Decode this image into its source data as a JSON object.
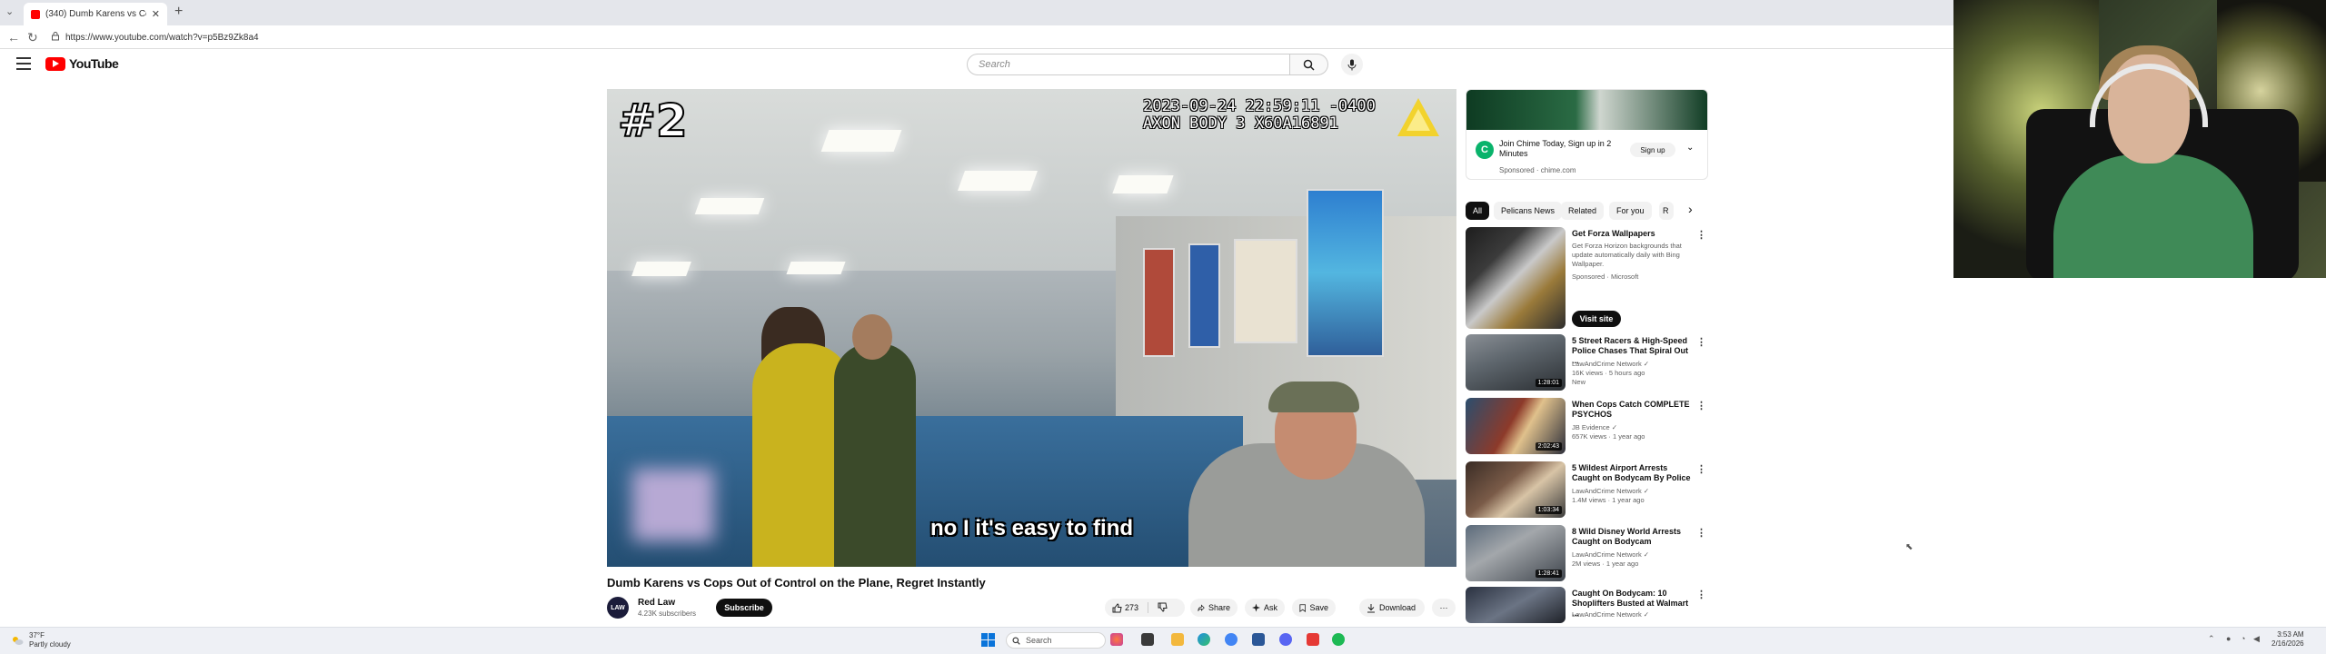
{
  "browser": {
    "tab_title": "(340) Dumb Karens vs Cops O",
    "url": "https://www.youtube.com/watch?v=p5Bz9Zk8a4",
    "newtab": "+",
    "close": "✕",
    "back": "←",
    "reload": "↻",
    "tab_dropdown": "⌄"
  },
  "header": {
    "logo_text": "YouTube",
    "search_placeholder": "Search"
  },
  "video": {
    "badge": "#2",
    "timestamp": "2023-09-24 22:59:11 -0400\nAXON BODY 3 X60A16891",
    "subtitle": "no I it's easy to find",
    "title": "Dumb Karens vs Cops Out of Control on the Plane, Regret Instantly",
    "channel_avatar": "LAW",
    "channel_name": "Red Law",
    "subscribers": "4.23K subscribers",
    "subscribe_label": "Subscribe",
    "likes": "273",
    "share_label": "Share",
    "ask_label": "Ask",
    "save_label": "Save",
    "download_label": "Download",
    "more": "···"
  },
  "ad": {
    "logo": "C",
    "text": "Join Chime Today, Sign up in 2 Minutes",
    "sponsored": "Sponsored · chime.com",
    "button": "Sign up",
    "chevron": "⌄"
  },
  "chips": [
    "All",
    "Pelicans News",
    "Related",
    "For you",
    "R"
  ],
  "chip_next": "›",
  "recommendations": [
    {
      "title": "Get Forza Wallpapers",
      "meta1": "Get Forza Horizon backgrounds that update automatically daily with Bing Wallpaper.",
      "meta2": "Sponsored · Microsoft",
      "visit": "Visit site",
      "duration": ""
    },
    {
      "title": "5 Street Racers & High-Speed Police Chases That Spiral Out ...",
      "meta1": "LawAndCrime Network ✓",
      "meta2": "16K views · 5 hours ago",
      "meta3": "New",
      "duration": "1:28:01"
    },
    {
      "title": "When Cops Catch COMPLETE PSYCHOS",
      "meta1": "JB Evidence ✓",
      "meta2": "657K views · 1 year ago",
      "meta3": "",
      "duration": "2:02:43"
    },
    {
      "title": "5 Wildest Airport Arrests Caught on Bodycam By Police",
      "meta1": "LawAndCrime Network ✓",
      "meta2": "1.4M views · 1 year ago",
      "meta3": "",
      "duration": "1:03:34"
    },
    {
      "title": "8 Wild Disney World Arrests Caught on Bodycam",
      "meta1": "LawAndCrime Network ✓",
      "meta2": "2M views · 1 year ago",
      "meta3": "",
      "duration": "1:28:41"
    },
    {
      "title": "Caught On Bodycam: 10 Shoplifters Busted at Walmart ...",
      "meta1": "LawAndCrime Network ✓",
      "meta2": "",
      "meta3": "",
      "duration": ""
    }
  ],
  "taskbar": {
    "temp": "37°F",
    "weather": "Partly cloudy",
    "search": "Search",
    "time": "3:53 AM",
    "date": "2/16/2026"
  },
  "colors": {
    "youtube_red": "#ff0000",
    "subscribe_bg": "#0f0f0f",
    "chime_green": "#09b36b"
  }
}
